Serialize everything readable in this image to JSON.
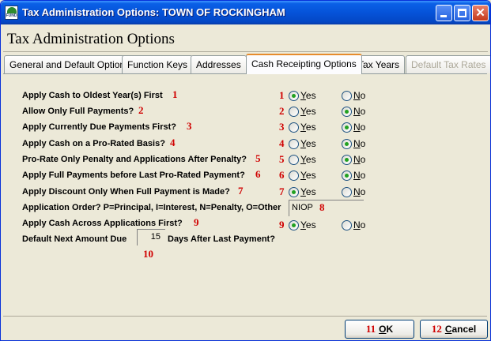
{
  "window": {
    "title": "Tax Administration Options: TOWN OF ROCKINGHAM",
    "icon_label": "FUND",
    "close_glyph": "✕"
  },
  "header": {
    "title": "Tax Administration Options"
  },
  "tabs": [
    {
      "label": "General and Default Options",
      "state": "normal"
    },
    {
      "label": "Function Keys",
      "state": "normal"
    },
    {
      "label": "Addresses",
      "state": "normal"
    },
    {
      "label": "Cash Receipting Options",
      "state": "active"
    },
    {
      "label": "Tax Years",
      "state": "normal"
    },
    {
      "label": "Default Tax Rates",
      "state": "disabled"
    }
  ],
  "options": [
    {
      "label": "Apply Cash to Oldest Year(s) First",
      "num": "1",
      "selected": "Yes"
    },
    {
      "label": "Allow Only Full Payments?",
      "num": "2",
      "selected": "No"
    },
    {
      "label": "Apply Currently Due Payments First?",
      "num": "3",
      "selected": "No"
    },
    {
      "label": "Apply Cash on a Pro-Rated Basis?",
      "num": "4",
      "selected": "No"
    },
    {
      "label": "Pro-Rate Only Penalty and Applications After Penalty?",
      "num": "5",
      "selected": "No"
    },
    {
      "label": "Apply Full Payments before Last Pro-Rated Payment?",
      "num": "6",
      "selected": "No"
    },
    {
      "label": "Apply Discount Only When Full Payment is Made?",
      "num": "7",
      "selected": "Yes"
    }
  ],
  "radio_labels": {
    "yes_u": "Y",
    "yes_rest": "es",
    "no_u": "N",
    "no_rest": "o"
  },
  "application_order": {
    "label": "Application Order? P=Principal, I=Interest, N=Penalty, O=Other",
    "value": "NIOP",
    "num": "8"
  },
  "apply_across": {
    "label": "Apply Cash Across Applications First?",
    "num": "9",
    "selected": "Yes"
  },
  "default_next_due": {
    "label_before": "Default Next Amount Due",
    "value": "15",
    "label_after": "Days After Last Payment?",
    "num": "10"
  },
  "buttons": {
    "ok": {
      "num": "11",
      "u": "O",
      "rest": "K"
    },
    "cancel": {
      "num": "12",
      "u": "C",
      "rest": "ancel"
    }
  }
}
